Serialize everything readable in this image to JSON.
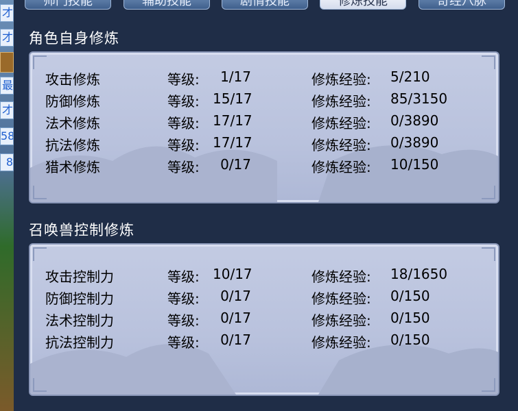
{
  "tabs": [
    {
      "label": "师门技能",
      "active": false
    },
    {
      "label": "辅助技能",
      "active": false
    },
    {
      "label": "剧情技能",
      "active": false
    },
    {
      "label": "修炼技能",
      "active": true
    },
    {
      "label": "奇经八脉",
      "active": false
    }
  ],
  "left_strip": [
    "才",
    "才",
    "最",
    "才",
    "58",
    "8"
  ],
  "self_cultivation": {
    "title": "角色自身修炼",
    "level_label": "等级:",
    "exp_label": "修炼经验:",
    "rows": [
      {
        "name": "攻击修炼",
        "level": "1/17",
        "exp": "5/210"
      },
      {
        "name": "防御修炼",
        "level": "15/17",
        "exp": "85/3150"
      },
      {
        "name": "法术修炼",
        "level": "17/17",
        "exp": "0/3890"
      },
      {
        "name": "抗法修炼",
        "level": "17/17",
        "exp": "0/3890"
      },
      {
        "name": "猎术修炼",
        "level": "0/17",
        "exp": "10/150"
      }
    ]
  },
  "pet_cultivation": {
    "title": "召唤兽控制修炼",
    "level_label": "等级:",
    "exp_label": "修炼经验:",
    "rows": [
      {
        "name": "攻击控制力",
        "level": "10/17",
        "exp": "18/1650"
      },
      {
        "name": "防御控制力",
        "level": "0/17",
        "exp": "0/150"
      },
      {
        "name": "法术控制力",
        "level": "0/17",
        "exp": "0/150"
      },
      {
        "name": "抗法控制力",
        "level": "0/17",
        "exp": "0/150"
      }
    ]
  }
}
